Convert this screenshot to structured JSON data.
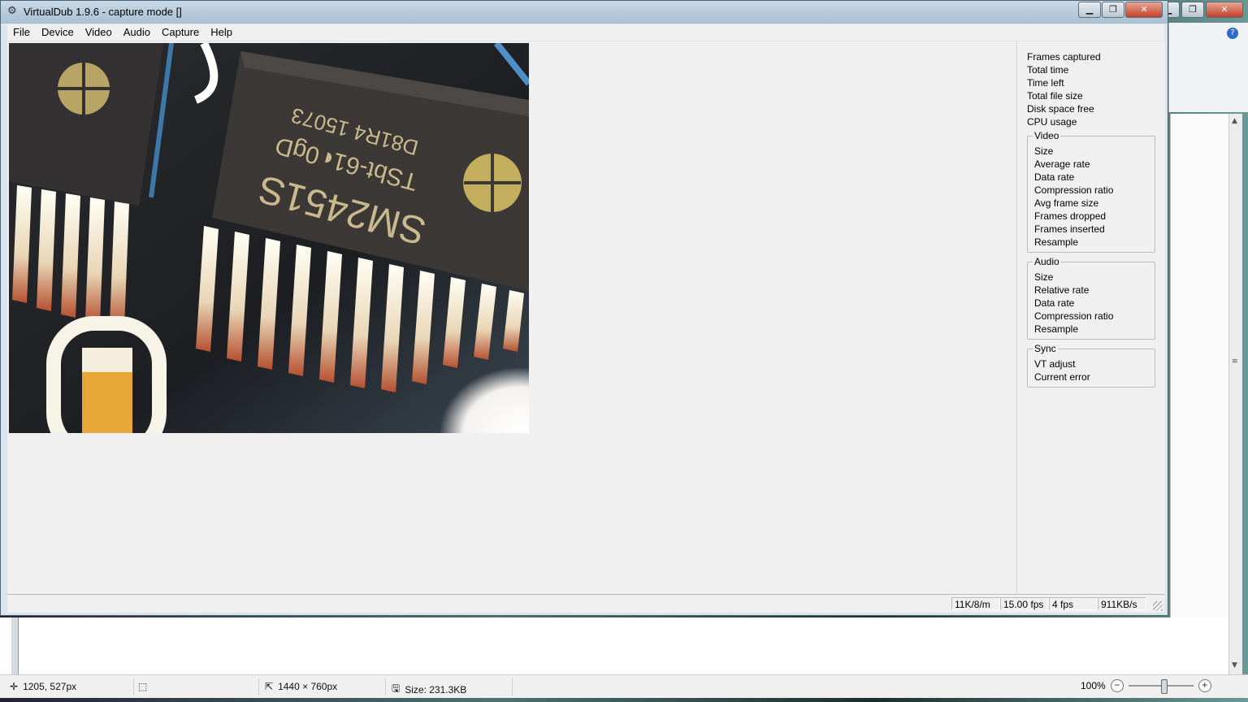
{
  "vdub": {
    "title": "VirtualDub 1.9.6 - capture mode []",
    "window_buttons": {
      "minimize": "▁",
      "maximize": "❐",
      "close": "✕"
    },
    "menu": [
      "File",
      "Device",
      "Video",
      "Audio",
      "Capture",
      "Help"
    ],
    "stats": [
      "Frames captured",
      "Total time",
      "Time left",
      "Total file size",
      "Disk space free",
      "CPU usage"
    ],
    "video_group": {
      "title": "Video",
      "items": [
        "Size",
        "Average rate",
        "Data rate",
        "Compression ratio",
        "Avg frame size",
        "Frames dropped",
        "Frames inserted",
        "Resample"
      ]
    },
    "audio_group": {
      "title": "Audio",
      "items": [
        "Size",
        "Relative rate",
        "Data rate",
        "Compression ratio",
        "Resample"
      ]
    },
    "sync_group": {
      "title": "Sync",
      "items": [
        "VT adjust",
        "Current error"
      ]
    },
    "status": [
      "11K/8/m",
      "15.00 fps",
      "4 fps",
      "911KB/s"
    ],
    "preview_chip": {
      "line1": "SM2451S",
      "line2": "TSbt-61◐0gD",
      "line3": "D81R4  15073"
    }
  },
  "paint": {
    "window_buttons": {
      "minimize": "▁",
      "maximize": "❐",
      "close": "✕"
    },
    "help": "?",
    "status": {
      "cursor": "1205, 527px",
      "dimensions": "1440 × 760px",
      "size": "Size: 231.3KB",
      "zoom": "100%"
    },
    "zoom_out": "−",
    "zoom_in": "+"
  }
}
